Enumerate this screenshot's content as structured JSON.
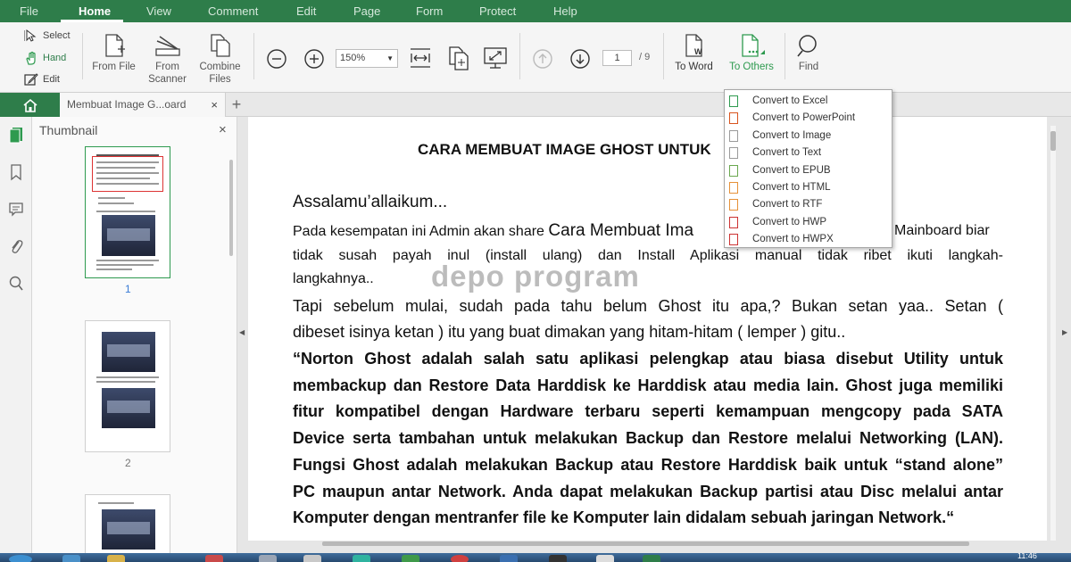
{
  "menu": {
    "items": [
      "File",
      "Home",
      "View",
      "Comment",
      "Edit",
      "Page",
      "Form",
      "Protect",
      "Help"
    ],
    "active": "Home"
  },
  "ribbon": {
    "select": "Select",
    "hand": "Hand",
    "edit": "Edit",
    "from_file": "From File",
    "from_scanner_1": "From",
    "from_scanner_2": "Scanner",
    "combine_1": "Combine",
    "combine_2": "Files",
    "zoom": "150%",
    "page_current": "1",
    "page_total": "/ 9",
    "to_word": "To Word",
    "to_others": "To Others",
    "find": "Find"
  },
  "tabs": {
    "document": "Membuat Image G...oard",
    "close": "×",
    "new": "+"
  },
  "thumbnail_panel": {
    "title": "Thumbnail",
    "close": "×",
    "pages": [
      "1",
      "2"
    ]
  },
  "document": {
    "title": "CARA MEMBUAT IMAGE GHOST UNTUK",
    "greeting": "Assalamu’allaikum...",
    "para1_line1_a": "Pada kesempatan ini Admin akan share",
    "para1_line1_b": "Cara Membuat Ima",
    "para1_line1_c": "Mainboard biar",
    "para1_line2": "tidak susah payah inul (install ulang) dan Install Aplikasi manual tidak  ribet ikuti langkah-",
    "para1_line3": "langkahnya..",
    "para2_line1": "Tapi sebelum mulai, sudah pada tahu belum Ghost itu apa,? Bukan setan yaa.. Setan (",
    "para2_line2": "dibeset isinya ketan )  itu yang buat dimakan yang hitam-hitam  ( lemper ) gitu..",
    "bold_lines": [
      "“Norton Ghost adalah salah satu aplikasi pelengkap atau biasa disebut Utility untuk",
      "membackup dan Restore Data Harddisk ke Harddisk atau media lain. Ghost juga memiliki",
      "fitur kompatibel dengan Hardware terbaru seperti kemampuan mengcopy pada SATA",
      "Device serta tambahan untuk melakukan Backup dan Restore melalui Networking (LAN).",
      "Fungsi Ghost adalah melakukan Backup atau Restore Harddisk baik untuk “stand alone”",
      "PC maupun antar Network. Anda dapat melakukan Backup partisi atau Disc melalui antar",
      "Komputer dengan mentranfer file ke Komputer lain didalam sebuah jaringan Network.“"
    ],
    "watermark": "depo program"
  },
  "convert_menu": {
    "items": [
      {
        "label": "Convert to Excel",
        "color": "#2e9a4f"
      },
      {
        "label": "Convert to PowerPoint",
        "color": "#d9541e"
      },
      {
        "label": "Convert to Image",
        "color": "#7a7a7a"
      },
      {
        "label": "Convert to Text",
        "color": "#7a7a7a"
      },
      {
        "label": "Convert to EPUB",
        "color": "#6aa84f"
      },
      {
        "label": "Convert to HTML",
        "color": "#e69138"
      },
      {
        "label": "Convert to RTF",
        "color": "#e69138"
      },
      {
        "label": "Convert to HWP",
        "color": "#cc3333"
      },
      {
        "label": "Convert to HWPX",
        "color": "#cc3333"
      }
    ]
  },
  "taskbar": {
    "clock": "11:46"
  },
  "colors": {
    "brand": "#2e7d4a",
    "accent": "#2e9a4f"
  }
}
